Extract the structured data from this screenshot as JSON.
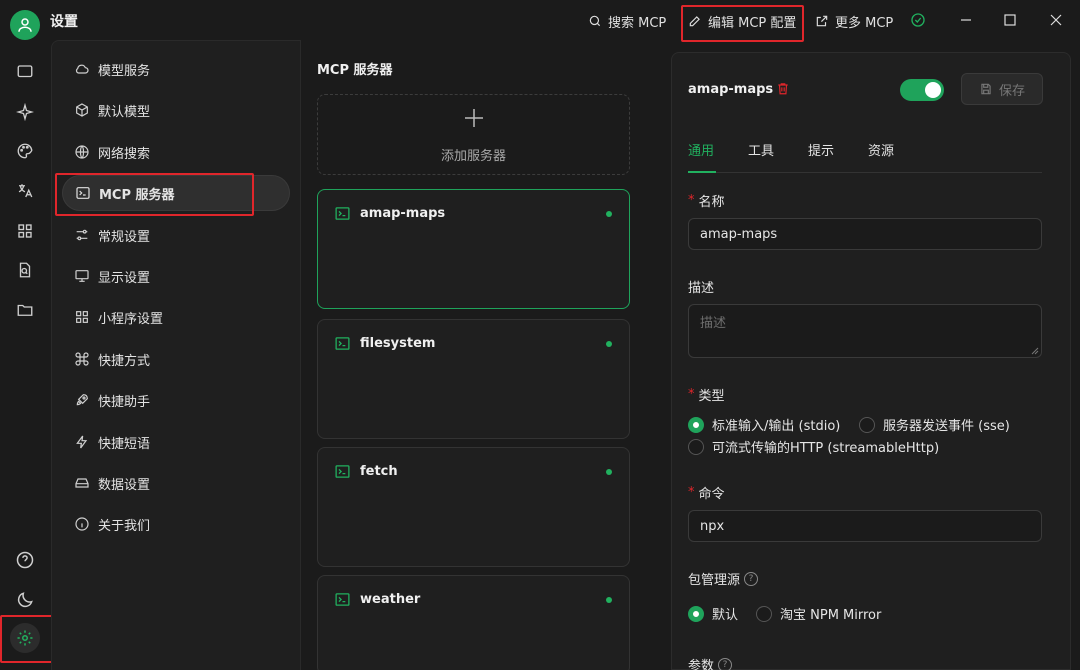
{
  "app": {
    "title": "设置",
    "toolbar": {
      "search_mcp": "搜索 MCP",
      "edit_mcp_config": "编辑 MCP 配置",
      "more_mcp": "更多 MCP"
    }
  },
  "rail": {
    "icons": [
      "chat-icon",
      "sparkle-icon",
      "palette-icon",
      "translate-icon",
      "apps-icon",
      "file-search-icon",
      "folder-icon",
      "help-icon",
      "moon-icon",
      "gear-icon"
    ]
  },
  "settings_nav": {
    "items": [
      {
        "label": "模型服务",
        "icon": "cloud-icon"
      },
      {
        "label": "默认模型",
        "icon": "cube-icon"
      },
      {
        "label": "网络搜索",
        "icon": "globe-icon"
      },
      {
        "label": "MCP 服务器",
        "icon": "terminal-icon"
      },
      {
        "label": "常规设置",
        "icon": "sliders-icon"
      },
      {
        "label": "显示设置",
        "icon": "monitor-icon"
      },
      {
        "label": "小程序设置",
        "icon": "grid-icon"
      },
      {
        "label": "快捷方式",
        "icon": "command-icon"
      },
      {
        "label": "快捷助手",
        "icon": "rocket-icon"
      },
      {
        "label": "快捷短语",
        "icon": "zap-icon"
      },
      {
        "label": "数据设置",
        "icon": "hard-drive-icon"
      },
      {
        "label": "关于我们",
        "icon": "info-icon"
      }
    ],
    "active_index": 3
  },
  "servers": {
    "title": "MCP 服务器",
    "add_label": "添加服务器",
    "items": [
      {
        "name": "amap-maps",
        "status_color": "#21b15f"
      },
      {
        "name": "filesystem",
        "status_color": "#21b15f"
      },
      {
        "name": "fetch",
        "status_color": "#21b15f"
      },
      {
        "name": "weather",
        "status_color": "#21b15f"
      }
    ],
    "selected_index": 0
  },
  "detail": {
    "server_name": "amap-maps",
    "enabled": true,
    "save_label": "保存",
    "tabs": [
      "通用",
      "工具",
      "提示",
      "资源"
    ],
    "active_tab": 0,
    "name_label": "名称",
    "name_value": "amap-maps",
    "desc_label": "描述",
    "desc_placeholder": "描述",
    "type_label": "类型",
    "type_options": [
      "标准输入/输出 (stdio)",
      "服务器发送事件 (sse)",
      "可流式传输的HTTP (streamableHttp)"
    ],
    "type_selected": 0,
    "command_label": "命令",
    "command_value": "npx",
    "pkg_label": "包管理源",
    "pkg_options": [
      "默认",
      "淘宝 NPM Mirror"
    ],
    "pkg_selected": 0,
    "args_label": "参数"
  },
  "colors": {
    "accent": "#1fa35b",
    "highlight_box": "#e0262b",
    "background": "#1b1b1b"
  }
}
